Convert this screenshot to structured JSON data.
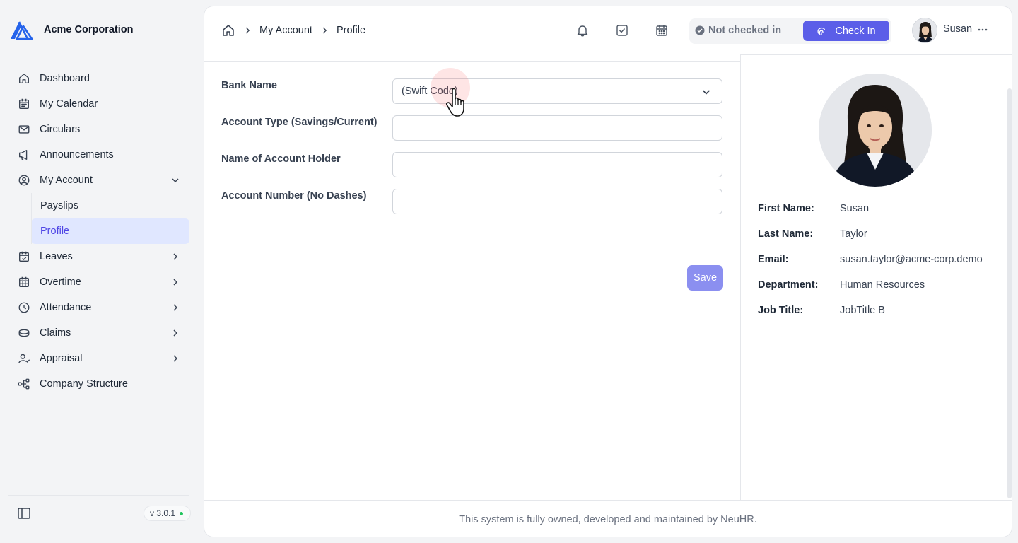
{
  "brand": {
    "name": "Acme Corporation"
  },
  "sidebar": {
    "items": [
      {
        "label": "Dashboard",
        "icon": "home-icon"
      },
      {
        "label": "My Calendar",
        "icon": "calendar-icon"
      },
      {
        "label": "Circulars",
        "icon": "mail-icon"
      },
      {
        "label": "Announcements",
        "icon": "megaphone-icon"
      },
      {
        "label": "My Account",
        "icon": "user-circle-icon",
        "expanded": true,
        "children": [
          {
            "label": "Payslips"
          },
          {
            "label": "Profile",
            "active": true
          }
        ]
      },
      {
        "label": "Leaves",
        "icon": "calendar-check-icon"
      },
      {
        "label": "Overtime",
        "icon": "calendar-grid-icon"
      },
      {
        "label": "Attendance",
        "icon": "clock-icon"
      },
      {
        "label": "Claims",
        "icon": "coins-icon"
      },
      {
        "label": "Appraisal",
        "icon": "user-check-icon"
      },
      {
        "label": "Company Structure",
        "icon": "org-chart-icon"
      }
    ],
    "version": "v 3.0.1"
  },
  "breadcrumb": {
    "level1": "My Account",
    "level2": "Profile"
  },
  "topbar": {
    "status": "Not checked in",
    "check_in_label": "Check In",
    "username": "Susan"
  },
  "form": {
    "bank_name_label": "Bank Name",
    "bank_name_value": "(Swift Code)",
    "account_type_label": "Account Type (Savings/Current)",
    "account_type_value": "",
    "holder_label": "Name of Account Holder",
    "holder_value": "",
    "account_number_label": "Account Number (No Dashes)",
    "account_number_value": "",
    "save_label": "Save"
  },
  "profile": {
    "first_name_label": "First Name:",
    "first_name": "Susan",
    "last_name_label": "Last Name:",
    "last_name": "Taylor",
    "email_label": "Email:",
    "email": "susan.taylor@acme-corp.demo",
    "department_label": "Department:",
    "department": "Human Resources",
    "job_title_label": "Job Title:",
    "job_title": "JobTitle B"
  },
  "footer": {
    "text": "This system is fully owned, developed and maintained by NeuHR."
  },
  "colors": {
    "accent": "#5b5ee8",
    "active_bg": "#e0e7ff",
    "active_text": "#4f46e5",
    "online": "#22c55e"
  }
}
